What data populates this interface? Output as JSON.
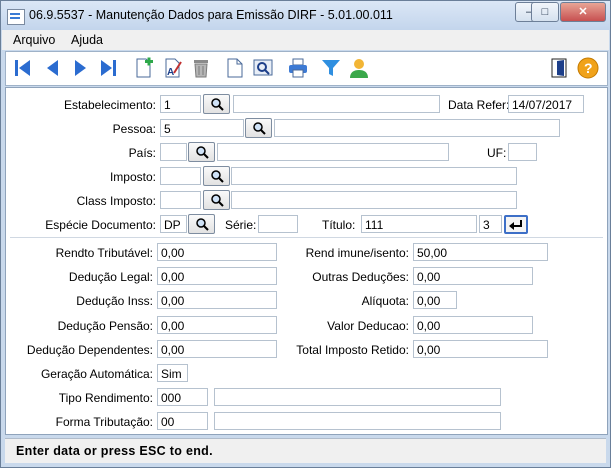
{
  "window": {
    "title": "06.9.5537 - Manutenção Dados para Emissão DIRF - 5.01.00.011"
  },
  "menu": {
    "arquivo": "Arquivo",
    "ajuda": "Ajuda"
  },
  "toolbar": {
    "icons": [
      "first-icon",
      "prev-icon",
      "next-icon",
      "last-icon",
      "add-icon",
      "edit-icon",
      "delete-icon",
      "new-doc-icon",
      "zoom-icon",
      "print-icon",
      "filter-icon",
      "user-icon",
      "exit-icon",
      "help-icon"
    ]
  },
  "form": {
    "estabelecimento": {
      "label": "Estabelecimento:",
      "value": "1",
      "desc": ""
    },
    "data_refer": {
      "label": "Data Refer:",
      "value": "14/07/2017"
    },
    "pessoa": {
      "label": "Pessoa:",
      "value": "5",
      "desc": ""
    },
    "pais": {
      "label": "País:",
      "value": "",
      "desc": ""
    },
    "uf": {
      "label": "UF:",
      "value": ""
    },
    "imposto": {
      "label": "Imposto:",
      "value": "",
      "desc": ""
    },
    "class_imposto": {
      "label": "Class Imposto:",
      "value": "",
      "desc": ""
    },
    "especie": {
      "label": "Espécie Documento:",
      "value": "DP"
    },
    "serie": {
      "label": "Série:",
      "value": ""
    },
    "titulo": {
      "label": "Título:",
      "value": "111",
      "parcela": "3"
    },
    "rendto_tributavel": {
      "label": "Rendto Tributável:",
      "value": "0,00"
    },
    "rend_imune": {
      "label": "Rend imune/isento:",
      "value": "50,00"
    },
    "deducao_legal": {
      "label": "Dedução Legal:",
      "value": "0,00"
    },
    "outras_deducoes": {
      "label": "Outras Deduções:",
      "value": "0,00"
    },
    "deducao_inss": {
      "label": "Dedução Inss:",
      "value": "0,00"
    },
    "aliquota": {
      "label": "Alíquota:",
      "value": "0,00"
    },
    "deducao_pensao": {
      "label": "Dedução Pensão:",
      "value": "0,00"
    },
    "valor_deducao": {
      "label": "Valor Deducao:",
      "value": "0,00"
    },
    "deducao_dependentes": {
      "label": "Dedução Dependentes:",
      "value": "0,00"
    },
    "total_imposto_retido": {
      "label": "Total Imposto Retido:",
      "value": "0,00"
    },
    "geracao_automatica": {
      "label": "Geração Automática:",
      "value": "Sim"
    },
    "tipo_rendimento": {
      "label": "Tipo Rendimento:",
      "value": "000",
      "desc": ""
    },
    "forma_tributacao": {
      "label": "Forma Tributação:",
      "value": "00",
      "desc": ""
    }
  },
  "status": {
    "text": "Enter data or press ESC to end."
  }
}
